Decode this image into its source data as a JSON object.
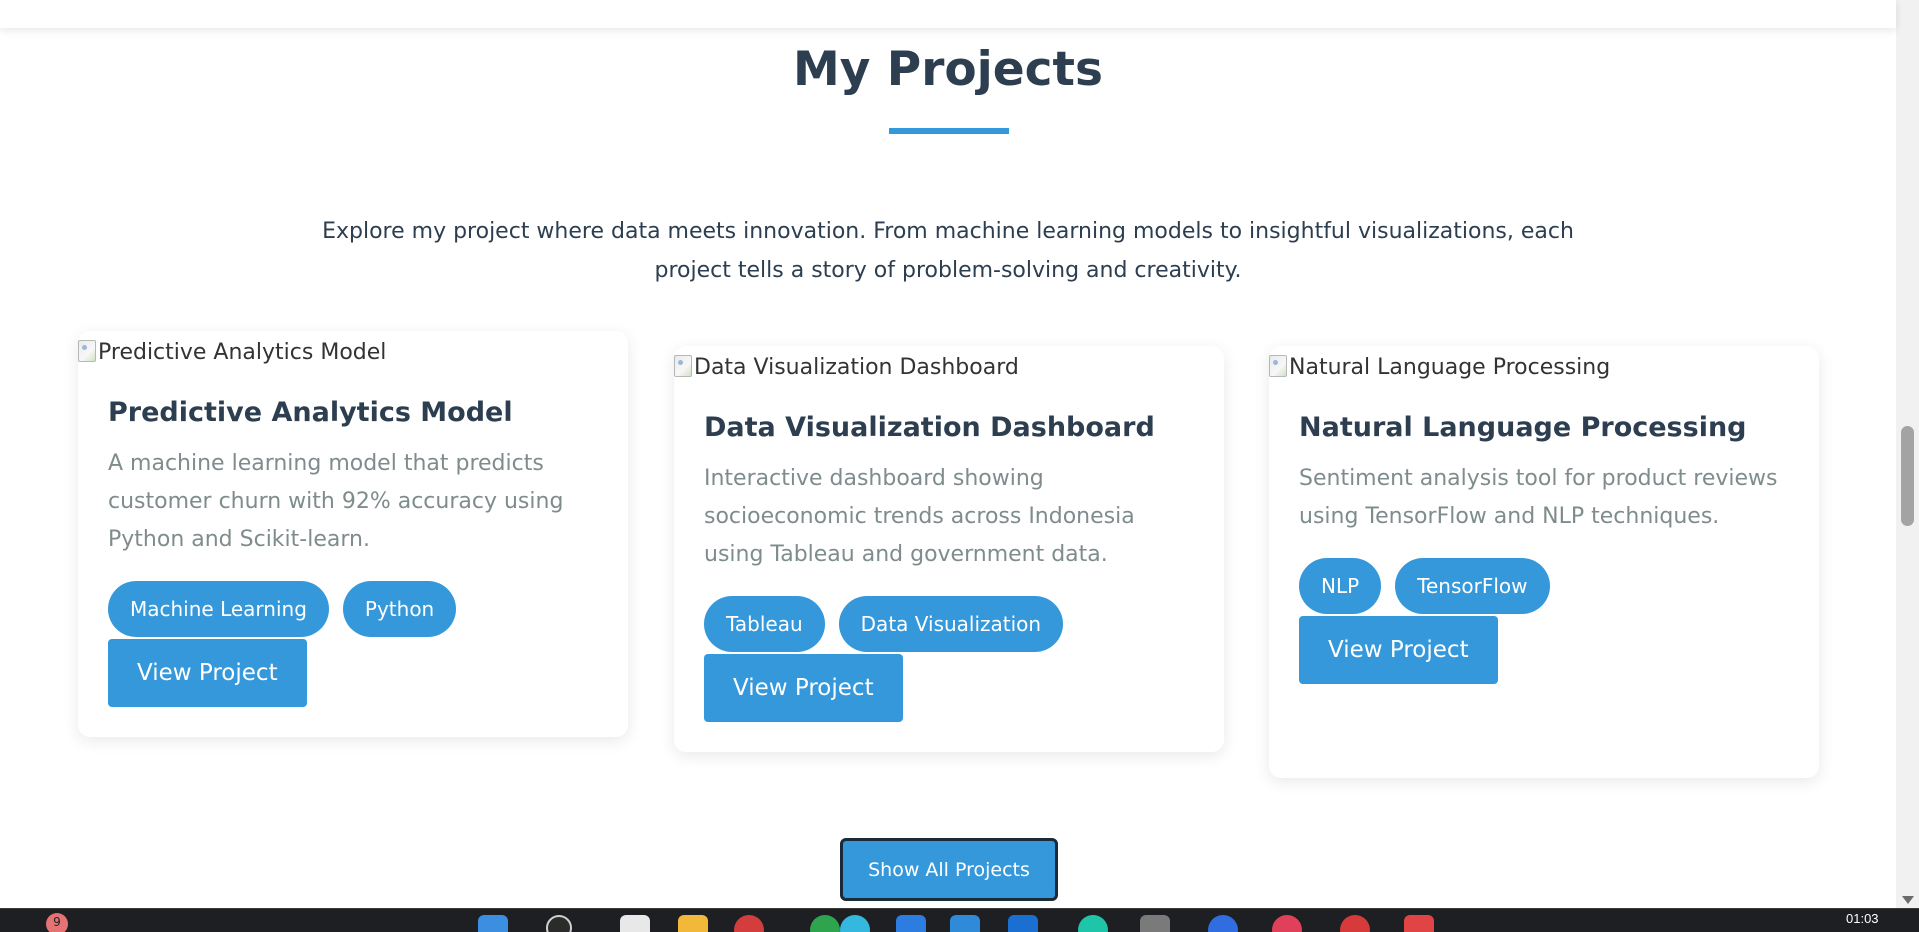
{
  "section": {
    "title": "My Projects",
    "intro": "Explore my project where data meets innovation. From machine learning models to insightful visualizations, each project tells a story of problem-solving and creativity."
  },
  "projects": [
    {
      "image_alt": "Predictive Analytics Model",
      "title": "Predictive Analytics Model",
      "description": "A machine learning model that predicts customer churn with 92% accuracy using Python and Scikit-learn.",
      "tags": [
        "Machine Learning",
        "Python"
      ],
      "button_label": "View Project"
    },
    {
      "image_alt": "Data Visualization Dashboard",
      "title": "Data Visualization Dashboard",
      "description": "Interactive dashboard showing socioeconomic trends across Indonesia using Tableau and government data.",
      "tags": [
        "Tableau",
        "Data Visualization"
      ],
      "button_label": "View Project"
    },
    {
      "image_alt": "Natural Language Processing",
      "title": "Natural Language Processing",
      "description": "Sentiment analysis tool for product reviews using TensorFlow and NLP techniques.",
      "tags": [
        "NLP",
        "TensorFlow"
      ],
      "button_label": "View Project"
    }
  ],
  "show_all_label": "Show All Projects",
  "taskbar": {
    "notification_count": "9",
    "clock": "01:03"
  },
  "colors": {
    "accent": "#3498db",
    "heading": "#2c3e50",
    "muted_text": "#7f8c8d"
  }
}
